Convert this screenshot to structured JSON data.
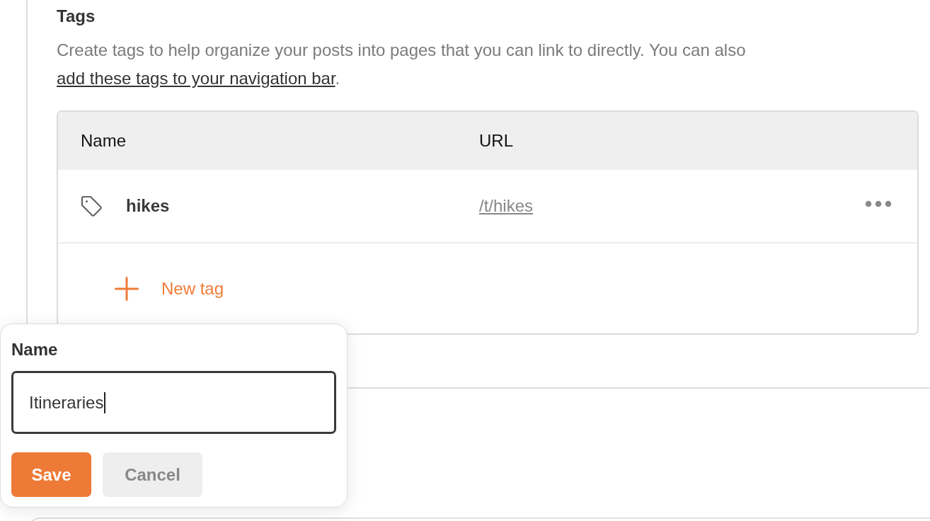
{
  "section": {
    "title": "Tags",
    "description": {
      "text": "Create tags to help organize your posts into pages that you can link to directly. You can also",
      "link": "add these tags to your navigation bar",
      "end": "."
    }
  },
  "table": {
    "columns": [
      "Name",
      "URL"
    ],
    "rows": [
      {
        "name": "hikes",
        "url": "/t/hikes"
      }
    ],
    "add_button": "New tag"
  },
  "popover": {
    "label": "Name",
    "value": "Itineraries",
    "focused": true,
    "buttons": [
      {
        "label": "Save",
        "kind": "primary"
      },
      {
        "label": "Cancel",
        "kind": "secondary"
      }
    ]
  }
}
